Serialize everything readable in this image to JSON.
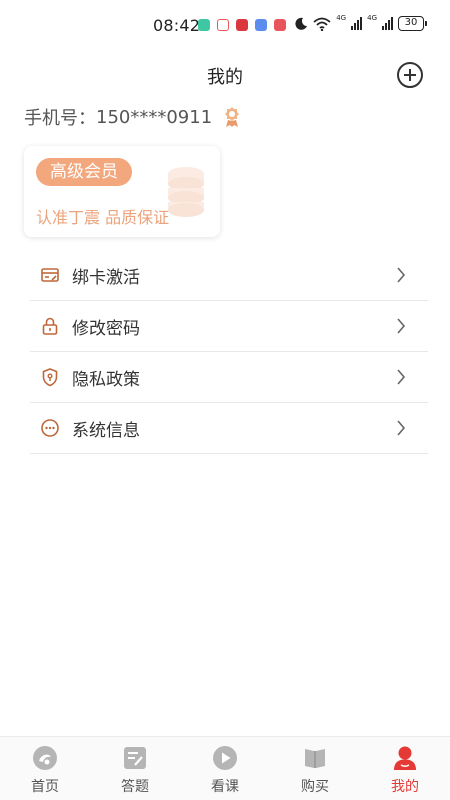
{
  "status_bar": {
    "time": "08:42",
    "network_1": "4G",
    "network_2": "4G",
    "battery": "30"
  },
  "header": {
    "title": "我的",
    "add_icon": "plus-circle-icon"
  },
  "account": {
    "phone_label": "手机号：",
    "phone_value": "150****0911",
    "badge_icon": "medal-icon"
  },
  "member_card": {
    "level": "高级会员",
    "slogan": "认准丁震 品质保证"
  },
  "menu": {
    "items": [
      {
        "label": "绑卡激活",
        "icon": "card-edit-icon"
      },
      {
        "label": "修改密码",
        "icon": "lock-icon"
      },
      {
        "label": "隐私政策",
        "icon": "shield-icon"
      },
      {
        "label": "系统信息",
        "icon": "more-dots-icon"
      }
    ]
  },
  "bottom_nav": {
    "items": [
      {
        "label": "首页",
        "icon": "home-icon"
      },
      {
        "label": "答题",
        "icon": "answer-icon"
      },
      {
        "label": "看课",
        "icon": "play-icon"
      },
      {
        "label": "购买",
        "icon": "book-icon"
      },
      {
        "label": "我的",
        "icon": "user-icon"
      }
    ],
    "active_color": "#e53935",
    "inactive_color": "#b5b5b5"
  },
  "colors": {
    "accent": "#f2a77d",
    "slogan": "#eba37c",
    "menu_icon": "#c0673a"
  }
}
